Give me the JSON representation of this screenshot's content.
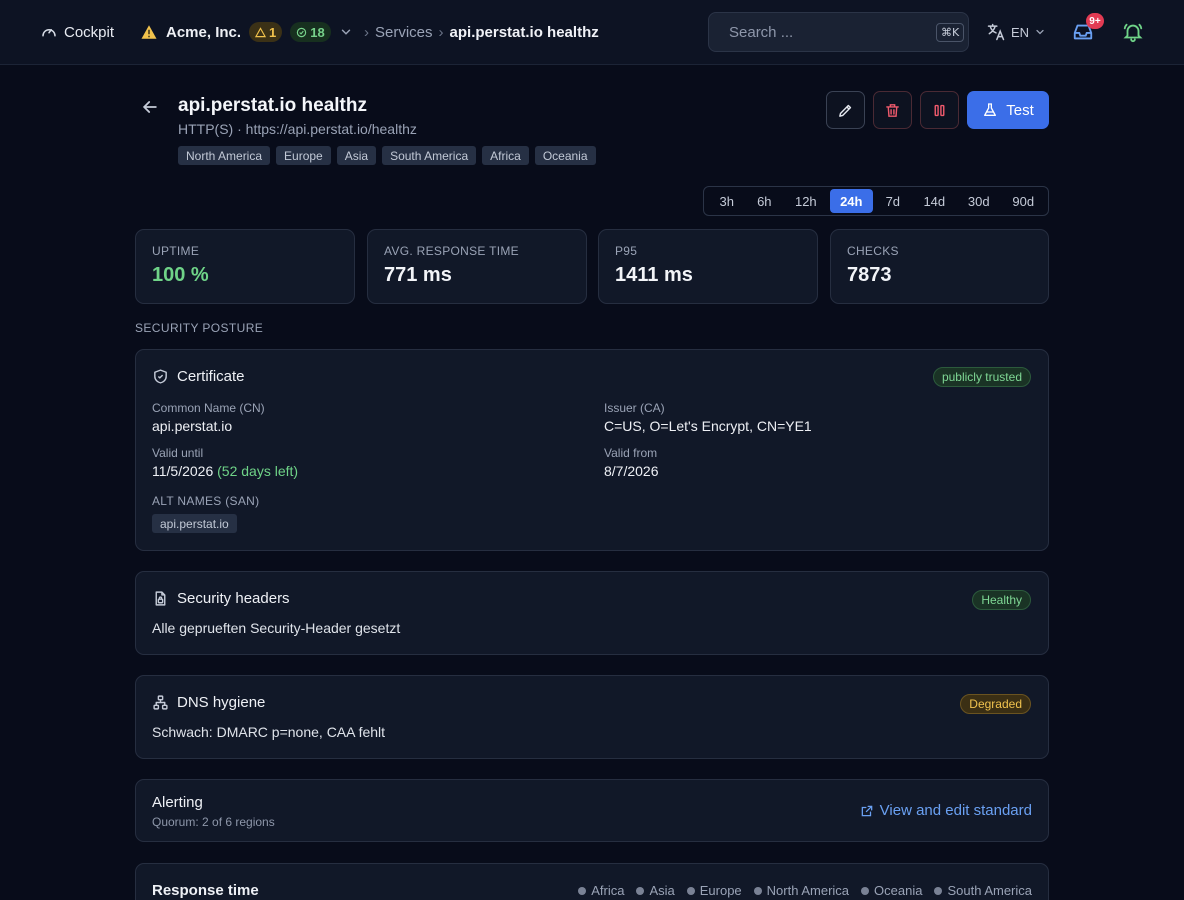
{
  "topbar": {
    "app_name": "Cockpit",
    "org_name": "Acme, Inc.",
    "warning_count": "1",
    "ok_count": "18",
    "breadcrumb_parent": "Services",
    "breadcrumb_current": "api.perstat.io healthz",
    "search_placeholder": "Search ...",
    "search_shortcut": "⌘K",
    "language": "EN",
    "inbox_badge": "9+"
  },
  "service": {
    "name": "api.perstat.io healthz",
    "subtitle": "HTTP(S) · https://api.perstat.io/healthz",
    "regions": [
      "North America",
      "Europe",
      "Asia",
      "South America",
      "Africa",
      "Oceania"
    ],
    "test_label": "Test"
  },
  "time_ranges": {
    "options": [
      "3h",
      "6h",
      "12h",
      "24h",
      "7d",
      "14d",
      "30d",
      "90d"
    ],
    "selected": "24h"
  },
  "stats": [
    {
      "label": "UPTIME",
      "value": "100 %"
    },
    {
      "label": "AVG. RESPONSE TIME",
      "value": "771 ms"
    },
    {
      "label": "P95",
      "value": "1411 ms"
    },
    {
      "label": "CHECKS",
      "value": "7873"
    }
  ],
  "security": {
    "section_title": "SECURITY POSTURE",
    "certificate": {
      "title": "Certificate",
      "status": "publicly trusted",
      "cn_label": "Common Name (CN)",
      "cn_value": "api.perstat.io",
      "issuer_label": "Issuer (CA)",
      "issuer_value": "C=US, O=Let's Encrypt, CN=YE1",
      "valid_until_label": "Valid until",
      "valid_until_value": "11/5/2026",
      "days_left": "(52 days left)",
      "valid_from_label": "Valid from",
      "valid_from_value": "8/7/2026",
      "san_label": "ALT NAMES (SAN)",
      "san_values": [
        "api.perstat.io"
      ]
    },
    "headers": {
      "title": "Security headers",
      "status": "Healthy",
      "text": "Alle geprueften Security-Header gesetzt"
    },
    "dns": {
      "title": "DNS hygiene",
      "status": "Degraded",
      "text": "Schwach: DMARC p=none, CAA fehlt"
    }
  },
  "alerting": {
    "title": "Alerting",
    "subtitle": "Quorum: 2 of 6 regions",
    "link": "View and edit standard"
  },
  "response_time": {
    "title": "Response time",
    "legend": [
      "Africa",
      "Asia",
      "Europe",
      "North America",
      "Oceania",
      "South America"
    ]
  },
  "colors": {
    "accent": "#3b6ee8",
    "success": "#6fd388",
    "warning": "#f0c24e",
    "danger": "#e23b53"
  }
}
